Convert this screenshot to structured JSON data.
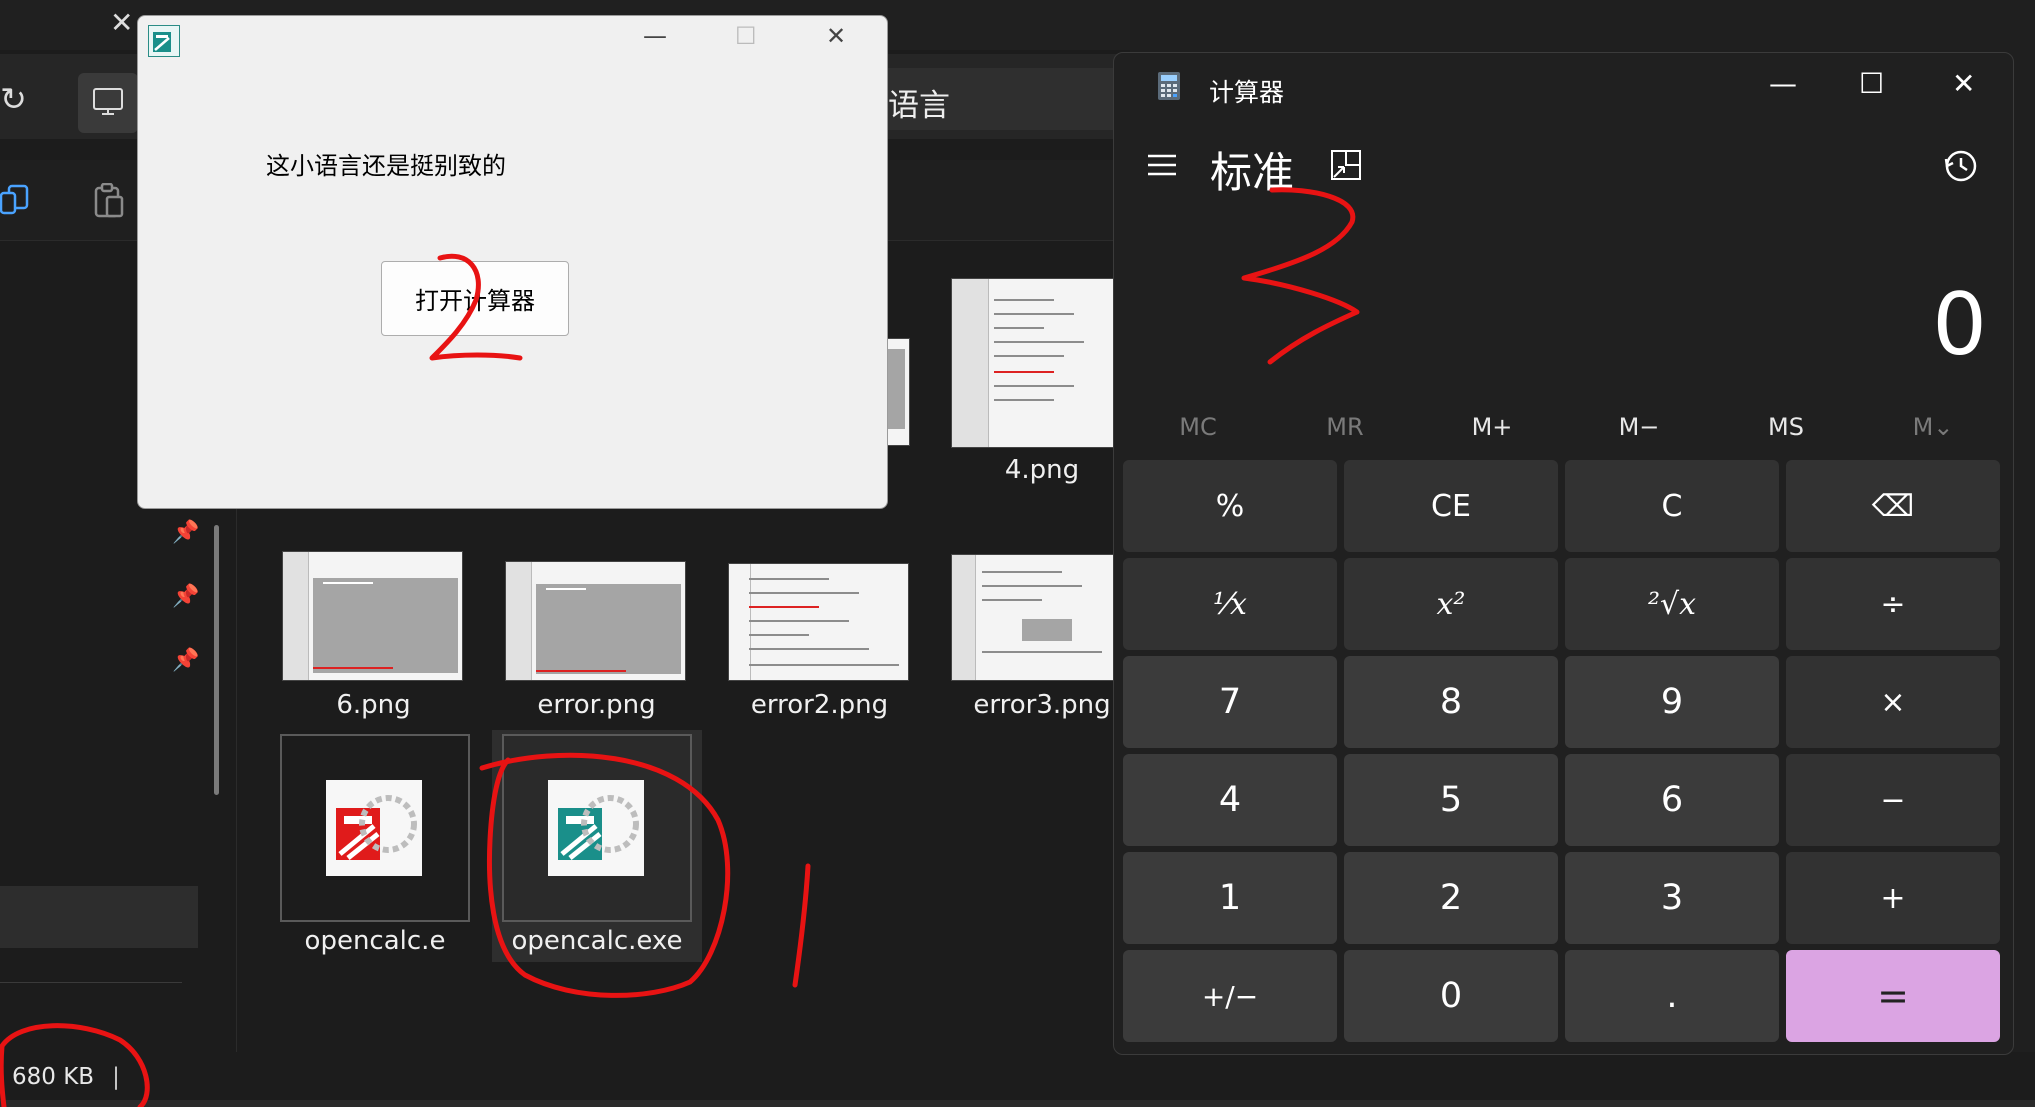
{
  "explorer": {
    "address_text": "语言",
    "status_size": "680 KB",
    "files": [
      {
        "name": "4.png"
      },
      {
        "name": "6.png"
      },
      {
        "name": "error.png"
      },
      {
        "name": "error2.png"
      },
      {
        "name": "error3.png"
      },
      {
        "name": "opencalc.e"
      },
      {
        "name": "opencalc.exe"
      }
    ],
    "close_glyph": "✕",
    "refresh_glyph": "↻",
    "pin_glyph": "📌"
  },
  "dialog": {
    "message": "这小语言还是挺别致的",
    "button_label": "打开计算器",
    "minimize_glyph": "—",
    "maximize_glyph": "☐",
    "close_glyph": "✕"
  },
  "calculator": {
    "title": "计算器",
    "mode": "标准",
    "display": "0",
    "minimize_glyph": "—",
    "maximize_glyph": "☐",
    "close_glyph": "✕",
    "memory": [
      "MC",
      "MR",
      "M+",
      "M−",
      "MS",
      "M⌄"
    ],
    "keys": [
      [
        "%",
        "CE",
        "C",
        "⌫"
      ],
      [
        "⅟x",
        "x²",
        "²√x",
        "÷"
      ],
      [
        "7",
        "8",
        "9",
        "×"
      ],
      [
        "4",
        "5",
        "6",
        "−"
      ],
      [
        "1",
        "2",
        "3",
        "+"
      ],
      [
        "+/−",
        "0",
        ".",
        "="
      ]
    ],
    "accent_color": "#dba4e3"
  },
  "annotations": {
    "color": "#e81313",
    "marks": [
      "1",
      "2",
      "3"
    ]
  }
}
